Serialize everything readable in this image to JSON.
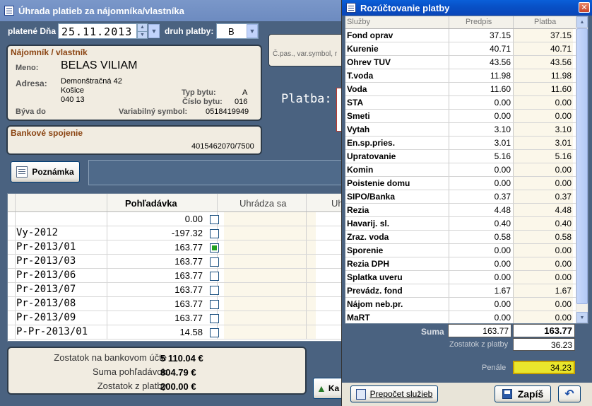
{
  "win1": {
    "title": "Úhrada platieb za nájomníka/vlastníka",
    "date_label": "platené Dňa",
    "date_value": "25.11.2013",
    "druh_label": "druh platby:",
    "druh_value": "B",
    "search_placeholder": "Č.pas., var.symbol, r",
    "platba_label": "Platba:",
    "tenant": {
      "title": "Nájomník / vlastník",
      "meno_label": "Meno:",
      "meno": "BELAS VILIAM",
      "adresa_label": "Adresa:",
      "adresa1": "Demonštračná 42",
      "adresa2": "Košice",
      "adresa3": "040 13",
      "typ_label": "Typ bytu:",
      "typ": "A",
      "cislo_label": "Číslo bytu:",
      "cislo": "016",
      "byva_label": "Býva do",
      "vs_label": "Variabilný symbol:",
      "vs": "0518419949"
    },
    "bank": {
      "title": "Bankové spojenie",
      "account": "4015462070/7500"
    },
    "note_button": "Poznámka",
    "grid": {
      "col_pohladavka": "Pohľadávka",
      "col_uhradza": "Uhrádza sa",
      "col_uh": "Uh",
      "rows": [
        {
          "name": "",
          "value": "0.00",
          "checked": false
        },
        {
          "name": "Vy-2012",
          "value": "-197.32",
          "checked": false
        },
        {
          "name": "Pr-2013/01",
          "value": "163.77",
          "checked": true
        },
        {
          "name": "Pr-2013/03",
          "value": "163.77",
          "checked": false
        },
        {
          "name": "Pr-2013/06",
          "value": "163.77",
          "checked": false
        },
        {
          "name": "Pr-2013/07",
          "value": "163.77",
          "checked": false
        },
        {
          "name": "Pr-2013/08",
          "value": "163.77",
          "checked": false
        },
        {
          "name": "Pr-2013/09",
          "value": "163.77",
          "checked": false
        },
        {
          "name": "P-Pr-2013/01",
          "value": "14.58",
          "checked": false
        }
      ]
    },
    "summary": {
      "zostatok_banka_label": "Zostatok na bankovom účte",
      "zostatok_banka": "5 110.04 €",
      "suma_pohl_label": "Suma pohľadávok",
      "suma_pohl": "804.79 €",
      "zostatok_platby_label": "Zostatok z platby",
      "zostatok_platby": "200.00 €"
    },
    "ka_button": "Ka"
  },
  "win2": {
    "title": "Rozúčtovanie platby",
    "col_sluzby": "Služby",
    "col_predpis": "Predpis",
    "col_platba": "Platba",
    "rows": [
      {
        "name": "Fond oprav",
        "predpis": "37.15",
        "platba": "37.15"
      },
      {
        "name": "Kurenie",
        "predpis": "40.71",
        "platba": "40.71"
      },
      {
        "name": "Ohrev TUV",
        "predpis": "43.56",
        "platba": "43.56"
      },
      {
        "name": "T.voda",
        "predpis": "11.98",
        "platba": "11.98"
      },
      {
        "name": "Voda",
        "predpis": "11.60",
        "platba": "11.60"
      },
      {
        "name": "STA",
        "predpis": "0.00",
        "platba": "0.00"
      },
      {
        "name": "Smeti",
        "predpis": "0.00",
        "platba": "0.00"
      },
      {
        "name": "Vytah",
        "predpis": "3.10",
        "platba": "3.10"
      },
      {
        "name": "En.sp.pries.",
        "predpis": "3.01",
        "platba": "3.01"
      },
      {
        "name": "Upratovanie",
        "predpis": "5.16",
        "platba": "5.16"
      },
      {
        "name": "Komin",
        "predpis": "0.00",
        "platba": "0.00"
      },
      {
        "name": "Poistenie domu",
        "predpis": "0.00",
        "platba": "0.00"
      },
      {
        "name": "SIPO/Banka",
        "predpis": "0.37",
        "platba": "0.37"
      },
      {
        "name": "Rezia",
        "predpis": "4.48",
        "platba": "4.48"
      },
      {
        "name": "Havarij. sl.",
        "predpis": "0.40",
        "platba": "0.40"
      },
      {
        "name": "Zraz. voda",
        "predpis": "0.58",
        "platba": "0.58"
      },
      {
        "name": "Sporenie",
        "predpis": "0.00",
        "platba": "0.00"
      },
      {
        "name": "Rezia DPH",
        "predpis": "0.00",
        "platba": "0.00"
      },
      {
        "name": "Splatka uveru",
        "predpis": "0.00",
        "platba": "0.00"
      },
      {
        "name": "Prevádz. fond",
        "predpis": "1.67",
        "platba": "1.67"
      },
      {
        "name": "Nájom neb.pr.",
        "predpis": "0.00",
        "platba": "0.00"
      },
      {
        "name": "MaRT",
        "predpis": "0.00",
        "platba": "0.00"
      }
    ],
    "suma_label": "Suma",
    "suma_predpis": "163.77",
    "suma_platba": "163.77",
    "zostatok_label": "Zostatok z platby",
    "zostatok": "36.23",
    "penale_label": "Penále",
    "penale": "34.23",
    "prepocet_button": "Prepočet služieb",
    "zapis_button": "Zapíš"
  }
}
